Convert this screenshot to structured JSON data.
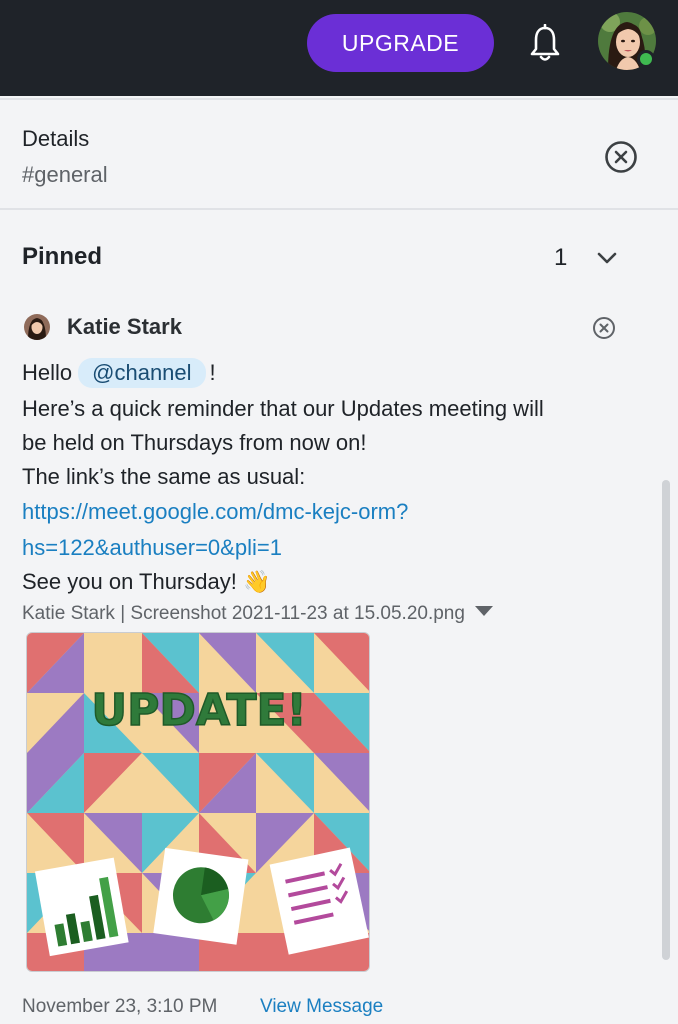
{
  "topbar": {
    "upgrade_label": "UPGRADE",
    "bell_icon": "bell-icon",
    "avatar_icon": "user-avatar",
    "status": "online"
  },
  "details": {
    "title": "Details",
    "channel": "#general",
    "close_icon": "close-circle-icon"
  },
  "pinned": {
    "title": "Pinned",
    "count": "1",
    "expand_icon": "chevron-down-icon"
  },
  "message": {
    "author": "Katie Stark",
    "greeting": "Hello",
    "mention": "@channel",
    "exclamation": "!",
    "line2": "Here’s a quick reminder that our Updates meeting will",
    "line3": "be held on Thursdays from now on!",
    "line4": "The link’s the same as usual:",
    "link_line1": "https://meet.google.com/dmc-kejc-orm?",
    "link_line2": "hs=122&authuser=0&pli=1",
    "closing": "See you on Thursday!",
    "emoji": "👋",
    "attachment_meta": "Katie Stark | Screenshot 2021-11-23 at 15.05.20.png",
    "image_text": "UPDATE!",
    "timestamp": "November 23, 3:10 PM",
    "view_label": "View Message"
  },
  "colors": {
    "topbar": "#1f2329",
    "accent": "#6b2fd6",
    "link": "#1a7fc1",
    "mention_bg": "#d8ecfa",
    "online": "#3fb950"
  }
}
